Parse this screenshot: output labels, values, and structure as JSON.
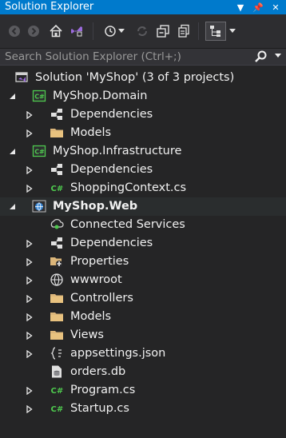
{
  "window": {
    "title": "Solution Explorer",
    "title_icons": [
      "dropdown-arrow",
      "pin",
      "close"
    ]
  },
  "search": {
    "placeholder": "Search Solution Explorer (Ctrl+;)"
  },
  "tree": [
    {
      "label": "Solution 'MyShop' (3 of 3 projects)",
      "icon": "solution-icon",
      "expander": "none",
      "level": 0
    },
    {
      "label": "MyShop.Domain",
      "icon": "csharp-project-icon",
      "expander": "expanded",
      "level": 1
    },
    {
      "label": "Dependencies",
      "icon": "dependencies-icon",
      "expander": "collapsed",
      "level": 2
    },
    {
      "label": "Models",
      "icon": "folder-icon",
      "expander": "collapsed",
      "level": 2
    },
    {
      "label": "MyShop.Infrastructure",
      "icon": "csharp-project-icon",
      "expander": "expanded",
      "level": 1
    },
    {
      "label": "Dependencies",
      "icon": "dependencies-icon",
      "expander": "collapsed",
      "level": 2
    },
    {
      "label": "ShoppingContext.cs",
      "icon": "csharp-file-icon",
      "expander": "collapsed",
      "level": 2
    },
    {
      "label": "MyShop.Web",
      "icon": "web-project-icon",
      "expander": "expanded",
      "level": 1,
      "bold": true,
      "selected": true
    },
    {
      "label": "Connected Services",
      "icon": "connected-services-icon",
      "expander": "none",
      "level": 2
    },
    {
      "label": "Dependencies",
      "icon": "dependencies-icon",
      "expander": "collapsed",
      "level": 2
    },
    {
      "label": "Properties",
      "icon": "properties-icon",
      "expander": "collapsed",
      "level": 2
    },
    {
      "label": "wwwroot",
      "icon": "globe-icon",
      "expander": "collapsed",
      "level": 2
    },
    {
      "label": "Controllers",
      "icon": "folder-icon",
      "expander": "collapsed",
      "level": 2
    },
    {
      "label": "Models",
      "icon": "folder-icon",
      "expander": "collapsed",
      "level": 2
    },
    {
      "label": "Views",
      "icon": "folder-icon",
      "expander": "collapsed",
      "level": 2
    },
    {
      "label": "appsettings.json",
      "icon": "json-file-icon",
      "expander": "collapsed",
      "level": 2
    },
    {
      "label": "orders.db",
      "icon": "db-file-icon",
      "expander": "none",
      "level": 2
    },
    {
      "label": "Program.cs",
      "icon": "csharp-file-icon",
      "expander": "collapsed",
      "level": 2
    },
    {
      "label": "Startup.cs",
      "icon": "csharp-file-icon",
      "expander": "collapsed",
      "level": 2
    }
  ],
  "colors": {
    "title_bar": "#007acc",
    "background": "#252526",
    "text": "#f1f1f1",
    "folder": "#dcb67a",
    "csharp": "#4ec94e",
    "selection": "#2a2d2e"
  }
}
